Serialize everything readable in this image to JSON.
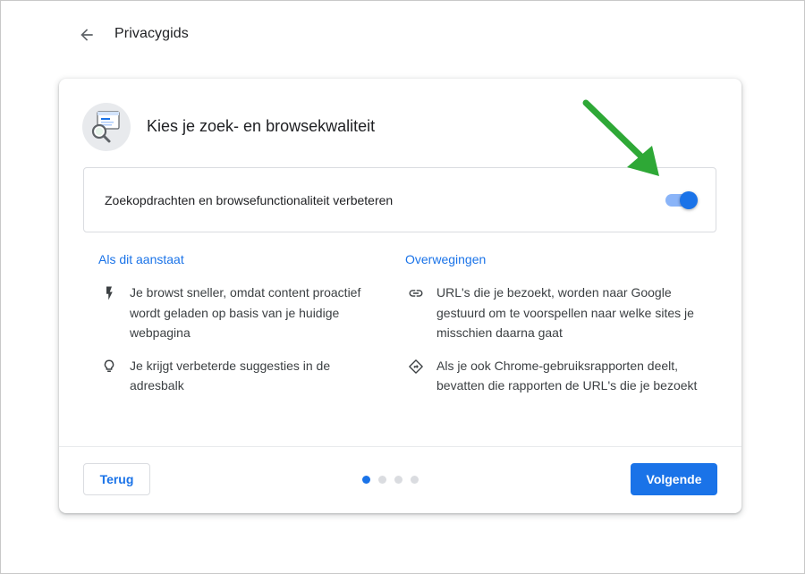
{
  "header": {
    "back_icon": "arrow-left-icon",
    "title": "Privacygids"
  },
  "card": {
    "illustration_icon": "search-magnifier-illustration-icon",
    "title": "Kies je zoek- en browsekwaliteit",
    "toggle": {
      "label": "Zoekopdrachten en browsefunctionaliteit verbeteren",
      "checked": true
    },
    "when_on": {
      "heading": "Als dit aanstaat",
      "items": [
        {
          "icon": "bolt-icon",
          "text": "Je browst sneller, omdat content proactief wordt geladen op basis van je huidige webpagina"
        },
        {
          "icon": "lightbulb-icon",
          "text": "Je krijgt verbeterde suggesties in de adresbalk"
        }
      ]
    },
    "considerations": {
      "heading": "Overwegingen",
      "items": [
        {
          "icon": "link-icon",
          "text": "URL's die je bezoekt, worden naar Google gestuurd om te voorspellen naar welke sites je misschien daarna gaat"
        },
        {
          "icon": "diamond-direction-icon",
          "text": "Als je ook Chrome-gebruiksrapporten deelt, bevatten die rapporten de URL's die je bezoekt"
        }
      ]
    },
    "footer": {
      "back_label": "Terug",
      "next_label": "Volgende",
      "step_current": 1,
      "step_total": 4
    }
  },
  "colors": {
    "accent": "#1a73e8",
    "toggle_track": "#8ab4f8",
    "annotation_arrow": "#2ea836"
  }
}
